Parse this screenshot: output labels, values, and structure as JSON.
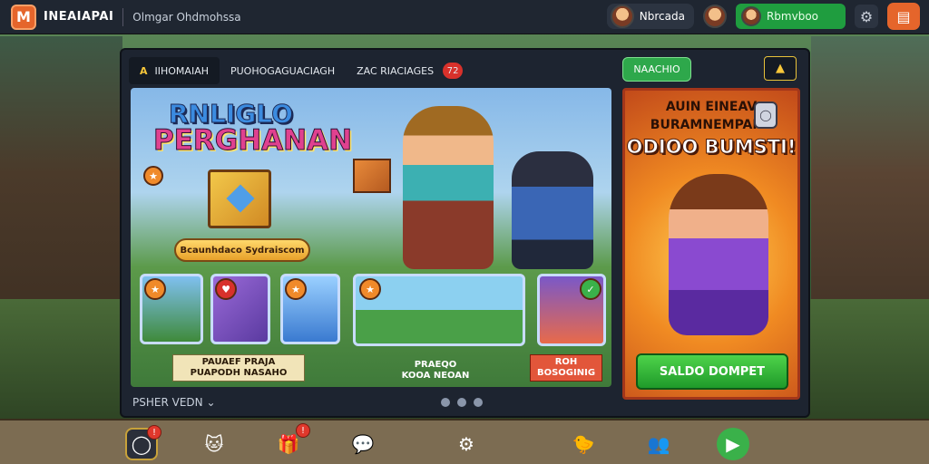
{
  "topbar": {
    "app_name": "INEAIAPAI",
    "app_subtitle": "Olmgar Ohdmohssa",
    "user_name": "Nbrcada",
    "currency_label": "Rbmvboo"
  },
  "tabs": [
    {
      "label": "IIHOMAIAH",
      "icon": "A"
    },
    {
      "label": "PUOHOGAGUACIAGH"
    },
    {
      "label": "ZAC RIACIAGES"
    }
  ],
  "tab_badge": "72",
  "new_button": "NAACHIO",
  "hero": {
    "title_line1": "RNLIGLO",
    "title_line2": "PERGHANAN",
    "cta": "Bcaunhdaco Sydraiscom"
  },
  "tiles": {
    "label_1": "PAUAEF PRAJA\nPUAPODH NASAHO",
    "label_2": "PRAEQO\nKOOA NEOAN",
    "label_3": "ROH\nBOSOGINIG"
  },
  "promo": {
    "line1": "AUIN EINEAV",
    "line2": "BURAMNEMPANS",
    "line3": "ODIOO BUMSTI!",
    "cta": "SALDO DOMPET"
  },
  "footer_label": "PSHER VEDN",
  "pagination": {
    "pages": 3,
    "current": 1
  }
}
